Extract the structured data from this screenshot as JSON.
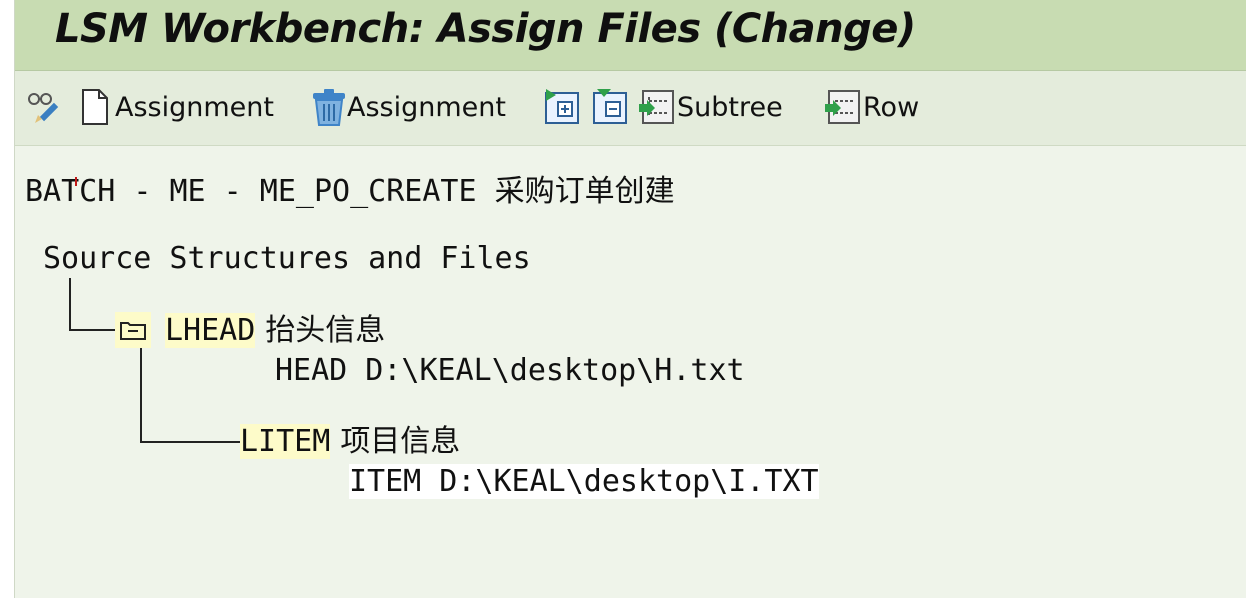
{
  "window": {
    "title": "LSM Workbench: Assign Files (Change)"
  },
  "toolbar": {
    "items": [
      {
        "icon": "glasses-pencil-icon",
        "label": ""
      },
      {
        "icon": "document-icon",
        "label": "Assignment"
      },
      {
        "icon": "trash-icon",
        "label": "Assignment"
      },
      {
        "icon": "expand-node-icon",
        "label": ""
      },
      {
        "icon": "collapse-node-icon",
        "label": ""
      },
      {
        "icon": "subtree-icon",
        "label": "Subtree"
      },
      {
        "icon": "row-icon",
        "label": "Row"
      }
    ]
  },
  "header": {
    "text": "BATCH - ME - ME_PO_CREATE 采购订单创建"
  },
  "tree": {
    "root_label": "Source Structures and Files",
    "nodes": [
      {
        "name": "LHEAD",
        "description": "抬头信息",
        "file": "HEAD D:\\KEAL\\desktop\\H.txt"
      },
      {
        "name": "LITEM",
        "description": "项目信息",
        "file": "ITEM D:\\KEAL\\desktop\\I.TXT"
      }
    ]
  }
}
